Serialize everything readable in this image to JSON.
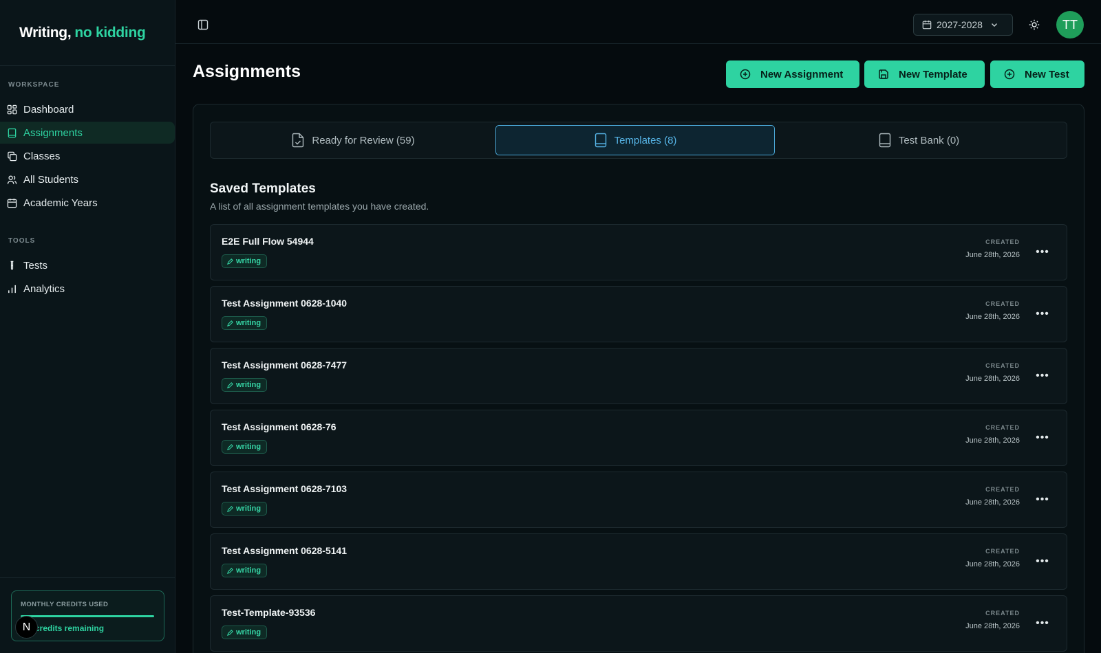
{
  "brand": {
    "part1": "Writing,",
    "part2": "no kidding"
  },
  "sidebar": {
    "workspace_heading": "WORKSPACE",
    "workspace_items": [
      {
        "label": "Dashboard",
        "icon": "dashboard-icon"
      },
      {
        "label": "Assignments",
        "icon": "notebook-icon",
        "active": true
      },
      {
        "label": "Classes",
        "icon": "copy-icon"
      },
      {
        "label": "All Students",
        "icon": "users-icon"
      },
      {
        "label": "Academic Years",
        "icon": "calendar-icon"
      }
    ],
    "tools_heading": "TOOLS",
    "tools_items": [
      {
        "label": "Tests",
        "icon": "test-tube-icon"
      },
      {
        "label": "Analytics",
        "icon": "bar-chart-icon"
      }
    ],
    "credits": {
      "label": "MONTHLY CREDITS USED",
      "remaining_text": "credits remaining",
      "used_fraction": 1.0,
      "badge": "N"
    }
  },
  "topbar": {
    "year": "2027-2028",
    "avatar_initials": "TT"
  },
  "page": {
    "title": "Assignments",
    "actions": [
      {
        "label": "New Assignment",
        "icon": "plus-circle-icon"
      },
      {
        "label": "New Template",
        "icon": "save-icon"
      },
      {
        "label": "New Test",
        "icon": "plus-circle-icon"
      }
    ]
  },
  "tabs": [
    {
      "label": "Ready for Review (59)",
      "icon": "file-check-icon",
      "active": false
    },
    {
      "label": "Templates (8)",
      "icon": "book-icon",
      "active": true
    },
    {
      "label": "Test Bank (0)",
      "icon": "book-icon",
      "active": false
    }
  ],
  "templates_section": {
    "title": "Saved Templates",
    "subtitle": "A list of all assignment templates you have created.",
    "created_label": "CREATED",
    "items": [
      {
        "name": "E2E Full Flow 54944",
        "tag": "writing",
        "created": "June 28th, 2026"
      },
      {
        "name": "Test Assignment 0628-1040",
        "tag": "writing",
        "created": "June 28th, 2026"
      },
      {
        "name": "Test Assignment 0628-7477",
        "tag": "writing",
        "created": "June 28th, 2026"
      },
      {
        "name": "Test Assignment 0628-76",
        "tag": "writing",
        "created": "June 28th, 2026"
      },
      {
        "name": "Test Assignment 0628-7103",
        "tag": "writing",
        "created": "June 28th, 2026"
      },
      {
        "name": "Test Assignment 0628-5141",
        "tag": "writing",
        "created": "June 28th, 2026"
      },
      {
        "name": "Test-Template-93536",
        "tag": "writing",
        "created": "June 28th, 2026"
      }
    ],
    "menu_glyph": "•••"
  },
  "colors": {
    "accent": "#2ed3a1",
    "active_tab": "#56b4e6",
    "background": "#050b0e",
    "avatar": "#1f9e5a"
  }
}
